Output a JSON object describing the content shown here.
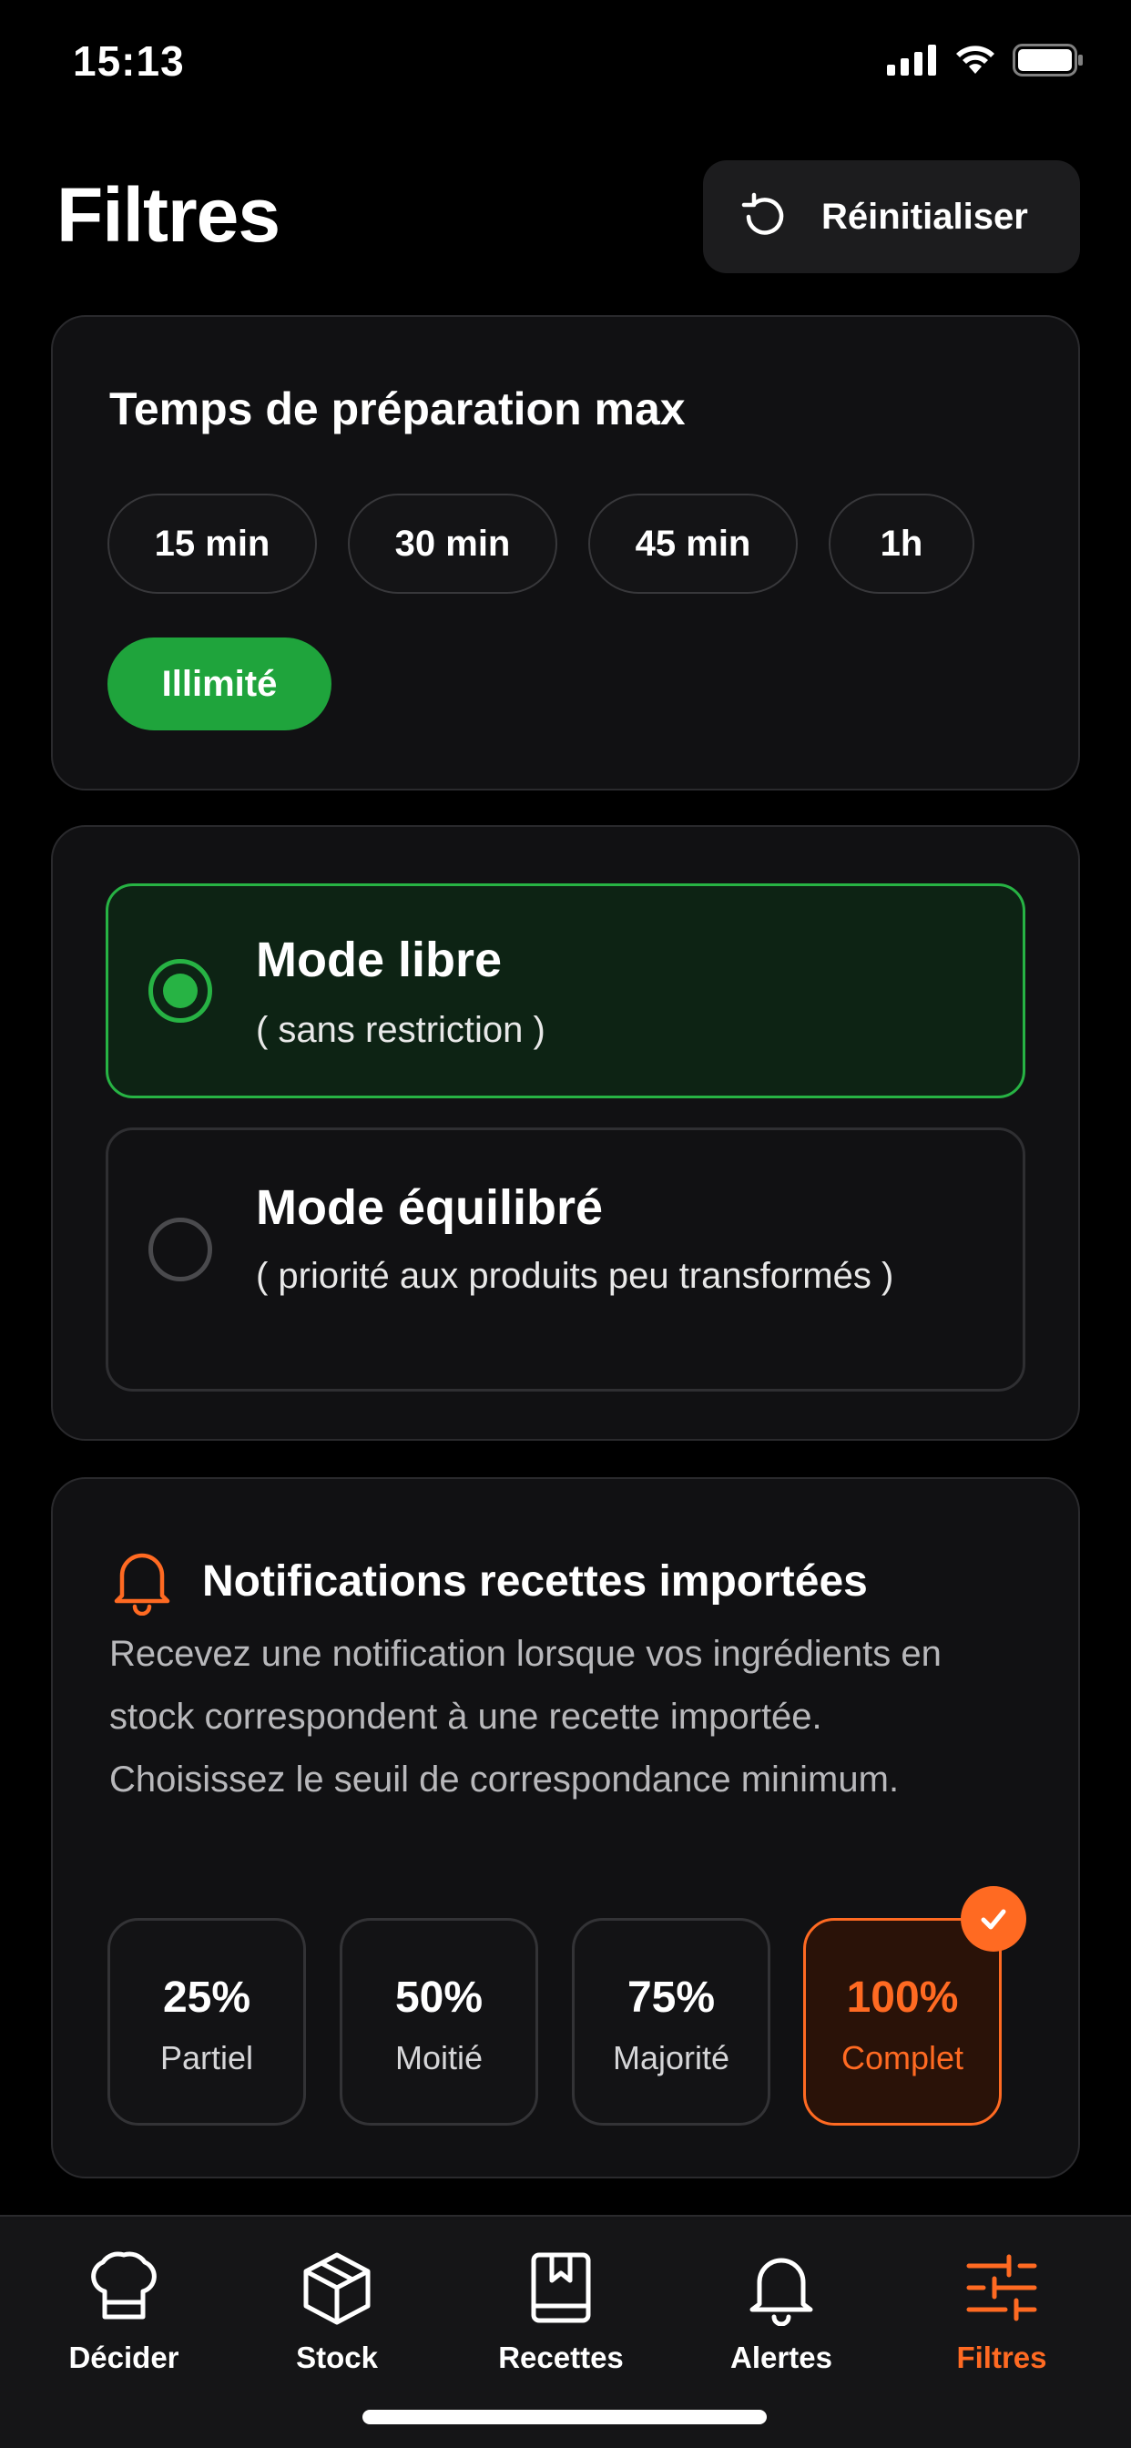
{
  "status_bar": {
    "time": "15:13",
    "icons": [
      "cellular-signal-icon",
      "wifi-icon",
      "battery-icon"
    ]
  },
  "header": {
    "title": "Filtres",
    "reset_label": "Réinitialiser",
    "reset_icon": "refresh-icon"
  },
  "prep_time": {
    "title": "Temps de préparation max",
    "options": [
      "15 min",
      "30 min",
      "45 min",
      "1h",
      "Illimité"
    ],
    "selected": "Illimité"
  },
  "modes": [
    {
      "title": "Mode libre",
      "subtitle": "( sans restriction )",
      "selected": true
    },
    {
      "title": "Mode équilibré",
      "subtitle": "( priorité aux produits peu transformés )",
      "selected": false
    }
  ],
  "notifications": {
    "icon": "bell-icon",
    "title": "Notifications recettes importées",
    "description": "Recevez une notification lorsque vos ingrédients en stock correspondent à une recette importée. Choisissez le seuil de correspondance minimum.",
    "thresholds": [
      {
        "value": "25%",
        "label": "Partiel"
      },
      {
        "value": "50%",
        "label": "Moitié"
      },
      {
        "value": "75%",
        "label": "Majorité"
      },
      {
        "value": "100%",
        "label": "Complet"
      }
    ],
    "selected": "100%"
  },
  "nav": {
    "items": [
      {
        "label": "Décider",
        "icon": "chef-hat-icon"
      },
      {
        "label": "Stock",
        "icon": "box-icon"
      },
      {
        "label": "Recettes",
        "icon": "recipe-book-icon"
      },
      {
        "label": "Alertes",
        "icon": "bell-icon"
      },
      {
        "label": "Filtres",
        "icon": "sliders-icon"
      }
    ],
    "active": "Filtres"
  },
  "colors": {
    "accent_green": "#1fa43c",
    "accent_orange": "#ff6a22",
    "background": "#000000",
    "card": "#111113"
  }
}
